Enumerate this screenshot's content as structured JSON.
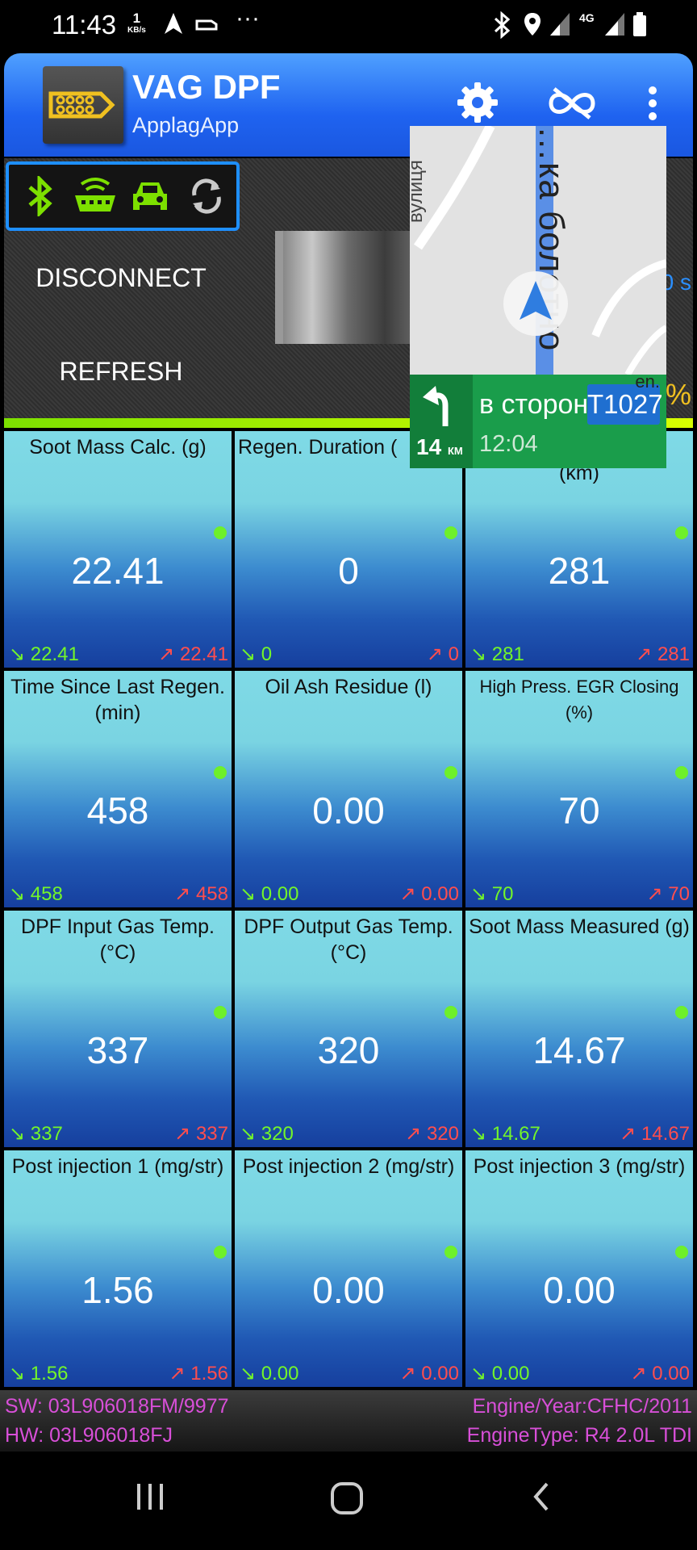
{
  "status_bar": {
    "time": "11:43",
    "data_rate_value": "1",
    "data_rate_unit": "KB/s",
    "more": "···",
    "network": "4G"
  },
  "app_bar": {
    "title": "VAG DPF",
    "subtitle": "ApplagApp",
    "icons": [
      "settings-icon",
      "infinity-icon",
      "more-vert-icon"
    ]
  },
  "connection": {
    "icons": [
      "bluetooth-icon",
      "obd-adapter-icon",
      "car-icon",
      "refresh-icon"
    ],
    "colors": {
      "active": "#7de000",
      "idle": "#c9c9c9",
      "border": "#1e8fff"
    }
  },
  "controls": {
    "disconnect": "DISCONNECT",
    "refresh": "REFRESH",
    "side_value_1": "0 s",
    "side_value_2": "%"
  },
  "navigation": {
    "street_main": "…ка болотно",
    "street_side": "вулиця",
    "distance": "14",
    "distance_unit": "КМ",
    "direction": "в сторону",
    "road": "T1027",
    "eta": "12:04",
    "hidden_tile_label_fragment": "en."
  },
  "tiles": [
    {
      "label": "Soot Mass Calc. (g)",
      "value": "22.41",
      "min": "22.41",
      "max": "22.41"
    },
    {
      "label": "Regen. Duration (",
      "value": "0",
      "min": "0",
      "max": "0"
    },
    {
      "label": "(km)",
      "value": "281",
      "min": "281",
      "max": "281"
    },
    {
      "label": "Time Since Last Regen. (min)",
      "value": "458",
      "min": "458",
      "max": "458"
    },
    {
      "label": "Oil Ash Residue (l)",
      "value": "0.00",
      "min": "0.00",
      "max": "0.00"
    },
    {
      "label": "High Press. EGR Closing (%)",
      "value": "70",
      "min": "70",
      "max": "70"
    },
    {
      "label": "DPF Input Gas Temp. (°C)",
      "value": "337",
      "min": "337",
      "max": "337"
    },
    {
      "label": "DPF Output Gas Temp. (°C)",
      "value": "320",
      "min": "320",
      "max": "320"
    },
    {
      "label": "Soot Mass Measured (g)",
      "value": "14.67",
      "min": "14.67",
      "max": "14.67"
    },
    {
      "label": "Post injection 1 (mg/str)",
      "value": "1.56",
      "min": "1.56",
      "max": "1.56"
    },
    {
      "label": "Post injection 2 (mg/str)",
      "value": "0.00",
      "min": "0.00",
      "max": "0.00"
    },
    {
      "label": "Post injection 3 (mg/str)",
      "value": "0.00",
      "min": "0.00",
      "max": "0.00"
    }
  ],
  "arrows": {
    "min": "↘",
    "max": "↗"
  },
  "footer": {
    "sw": "SW: 03L906018FM/9977",
    "hw": "HW: 03L906018FJ",
    "engine_year": "Engine/Year:CFHC/2011",
    "engine_type": "EngineType: R4 2.0L TDI",
    "color": "#d84fd8"
  },
  "system_nav": [
    "recent-apps-icon",
    "home-icon",
    "back-icon"
  ]
}
